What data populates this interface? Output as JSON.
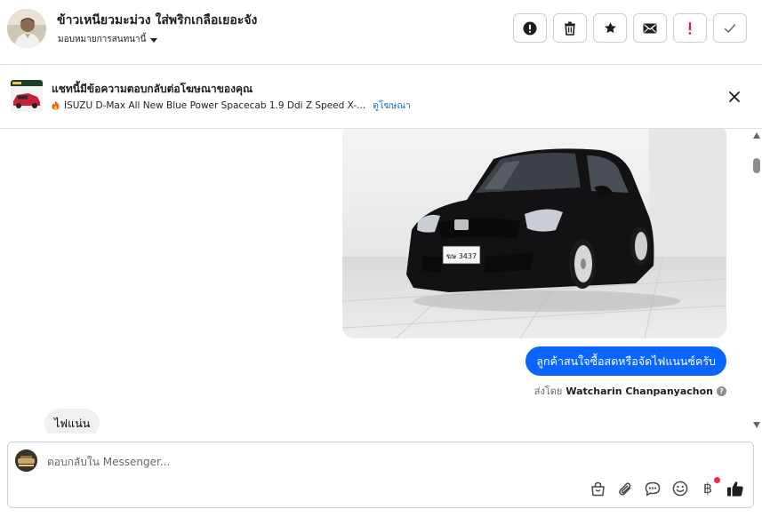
{
  "header": {
    "title": "ข้าวเหนียวมะม่วง ใส่พริกเกลือเยอะจัง",
    "assign_label": "มอบหมายการสนทนานี้",
    "actions": [
      {
        "name": "report-button",
        "icon": "exclamation-circle-icon"
      },
      {
        "name": "delete-button",
        "icon": "trash-icon"
      },
      {
        "name": "star-button",
        "icon": "star-icon"
      },
      {
        "name": "mark-unread-button",
        "icon": "envelope-icon"
      },
      {
        "name": "follow-up-button",
        "icon": "red-exclamation-icon"
      },
      {
        "name": "mark-done-button",
        "icon": "check-icon"
      }
    ]
  },
  "ad_banner": {
    "title": "แชทนี้มีข้อความตอบกลับต่อโฆษณาของคุณ",
    "ad_text": "ISUZU D-Max All New Blue Power Spacecab 1.9 Ddi Z Speed X-...",
    "link_text": "ดูโฆษณา"
  },
  "messages": {
    "outgoing_text": "ลูกค้าสนใจซื้อสดหรือจัดไฟแนนซ์ครับ",
    "sent_by_prefix": "ส่งโดย",
    "sent_by_name": "Watcharin Chanpanyachon",
    "incoming_text": "ไฟแน่น",
    "car_plate": "ฆษ 3437"
  },
  "composer": {
    "placeholder": "ตอบกลับใน Messenger..."
  },
  "colors": {
    "accent": "#0866ff",
    "follow_up_red": "#e41e3f",
    "notification_dot": "#f02849"
  }
}
